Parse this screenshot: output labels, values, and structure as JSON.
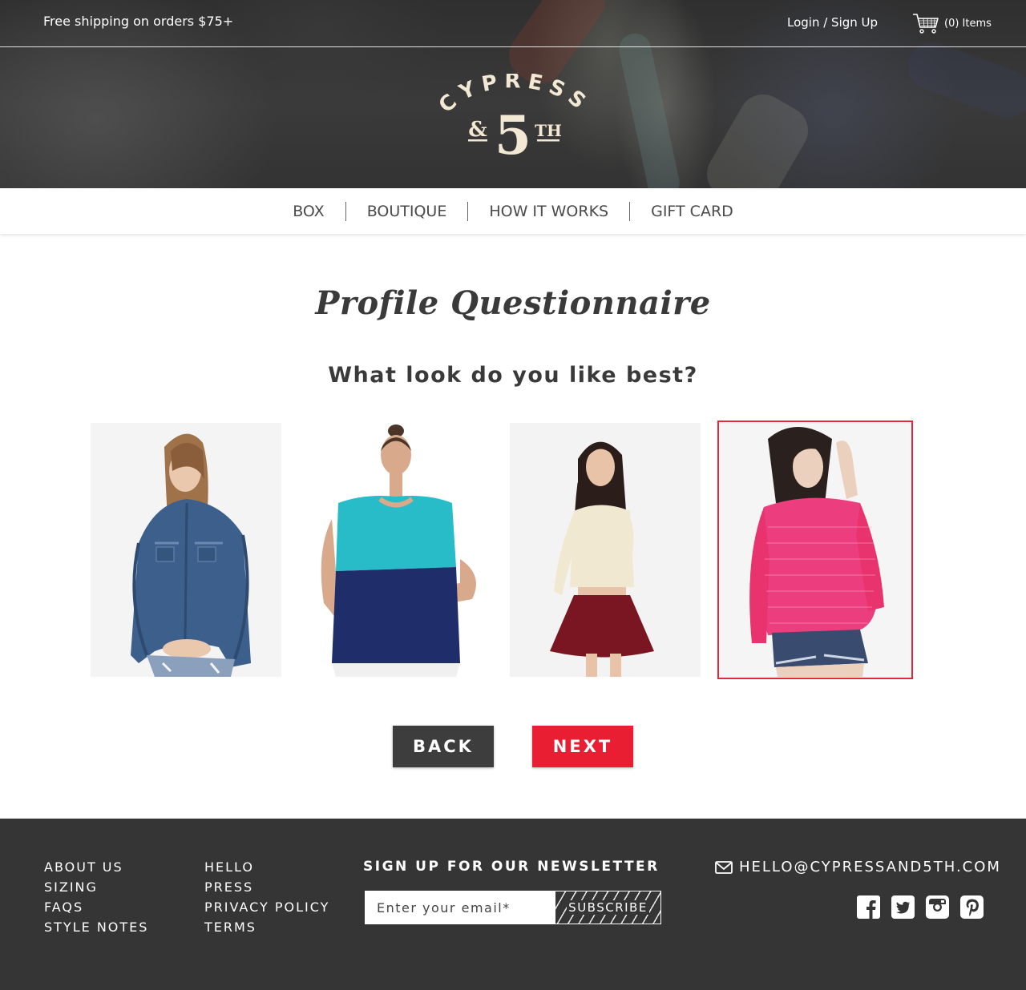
{
  "topbar": {
    "shipping_text": "Free shipping on orders $75+",
    "login_text": "Login / Sign Up",
    "cart_text": "(0) Items",
    "cart_icon": "shopping-cart-icon"
  },
  "logo": {
    "line1": "CYPRESS",
    "ampersand": "&",
    "number": "5",
    "suffix": "TH"
  },
  "nav": {
    "items": [
      {
        "label": "BOX"
      },
      {
        "label": "BOUTIQUE"
      },
      {
        "label": "HOW IT WORKS"
      },
      {
        "label": "GIFT CARD"
      }
    ]
  },
  "main": {
    "title": "Profile Questionnaire",
    "question": "What look do you like best?",
    "options": [
      {
        "name": "denim-jacket-look",
        "selected": false
      },
      {
        "name": "colorblock-top-look",
        "selected": false
      },
      {
        "name": "crop-top-skirt-look",
        "selected": false
      },
      {
        "name": "pink-sweater-look",
        "selected": true
      }
    ],
    "selected_color": "#e8263a",
    "back_label": "BACK",
    "next_label": "NEXT"
  },
  "footer": {
    "col1": [
      "ABOUT US",
      "SIZING",
      "FAQS",
      "STYLE NOTES"
    ],
    "col2": [
      "HELLO",
      "PRESS",
      "PRIVACY POLICY",
      "TERMS"
    ],
    "newsletter_title": "SIGN UP FOR OUR NEWSLETTER",
    "email_placeholder": "Enter your email*",
    "subscribe_label": "SUBSCRIBE",
    "contact_email": "HELLO@CYPRESSAND5TH.COM",
    "social_icons": [
      "facebook-icon",
      "twitter-icon",
      "instagram-icon",
      "pinterest-icon"
    ]
  },
  "colors": {
    "accent": "#ea1e33",
    "dark_button": "#3d3d3d",
    "footer_bg": "#353535",
    "logo_cream": "#f3e8d3"
  }
}
